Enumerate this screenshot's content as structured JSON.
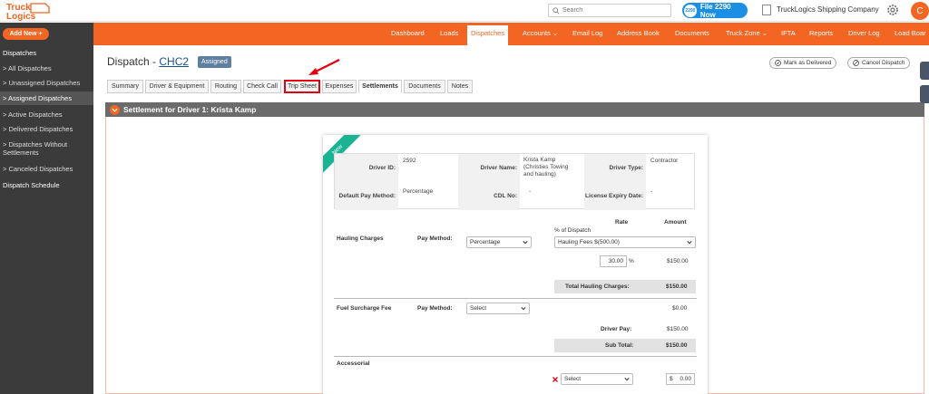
{
  "brand": {
    "logo_line1": "Truck",
    "logo_line2": "Logics"
  },
  "header": {
    "search_placeholder": "Search",
    "file_button_badge": "2290",
    "file_button_label": "File 2290 Now",
    "company_name": "TruckLogics Shipping Company",
    "avatar_initial": "C"
  },
  "sidebar": {
    "add_new": "Add New +",
    "section": "Dispatches",
    "items": [
      {
        "label": "> All Dispatches"
      },
      {
        "label": "> Unassigned Dispatches"
      },
      {
        "label": "> Assigned Dispatches"
      },
      {
        "label": "> Active Dispatches"
      },
      {
        "label": "> Delivered Dispatches"
      },
      {
        "label": "> Dispatches Without Settlements"
      },
      {
        "label": "> Canceled Dispatches"
      }
    ],
    "schedule": "Dispatch Schedule"
  },
  "nav": {
    "items": [
      "Dashboard",
      "Loads",
      "Dispatches",
      "Accounts ⌄",
      "Email Log",
      "Address Book",
      "Documents",
      "Truck Zone ⌄",
      "IFTA",
      "Reports",
      "Driver Log",
      "Load Boar"
    ]
  },
  "page": {
    "title_prefix": "Dispatch - ",
    "dispatch_id": "CHC2",
    "status": "Assigned",
    "mark_delivered": "Mark as Delivered",
    "cancel_dispatch": "Cancel Dispatch"
  },
  "tabs": [
    "Summary",
    "Driver & Equipment",
    "Routing",
    "Check Call",
    "Trip Sheet",
    "Expenses",
    "Settlements",
    "Documents",
    "Notes"
  ],
  "section": {
    "title": "Settlement for Driver 1: Krista Kamp"
  },
  "card": {
    "ribbon": "New",
    "driver_id_label": "Driver ID:",
    "driver_id": "2592",
    "driver_name_label": "Driver Name:",
    "driver_name": "Krista Kamp (Christies Towing and hauling)",
    "driver_type_label": "Driver Type:",
    "driver_type": "Contractor",
    "pay_method_label": "Default Pay Method:",
    "pay_method": "Percentage",
    "cdl_label": "CDL No:",
    "cdl": "-",
    "license_label": "License Expiry Date:",
    "license": "-",
    "rate_header": "Rate",
    "amount_header": "Amount",
    "hauling_label": "Hauling Charges",
    "pay_method_field_label": "Pay Method:",
    "hauling_pay_method": "Percentage",
    "pct_of_dispatch": "% of Dispatch",
    "hauling_fee_select": "Hauling Fees $(500.00)",
    "pct_value": "30.00",
    "pct_symbol": "%",
    "hauling_amount": "$150.00",
    "total_hauling_label": "Total Hauling Charges:",
    "total_hauling": "$150.00",
    "fuel_label": "Fuel Surcharge Fee",
    "fuel_pay_method_label": "Pay Method:",
    "fuel_pay_method": "Select",
    "fuel_amount": "$0.00",
    "driver_pay_label": "Driver Pay:",
    "driver_pay": "$150.00",
    "subtotal_label": "Sub Total:",
    "subtotal": "$150.00",
    "accessorial_label": "Accessorial",
    "accessorial_select": "Select",
    "accessorial_currency": "$",
    "accessorial_amount": "0.00"
  },
  "colors": {
    "brand": "#f26522",
    "sidebar": "#3b3b3b",
    "ribbon": "#1ab394",
    "highlight": "#e3000f"
  }
}
